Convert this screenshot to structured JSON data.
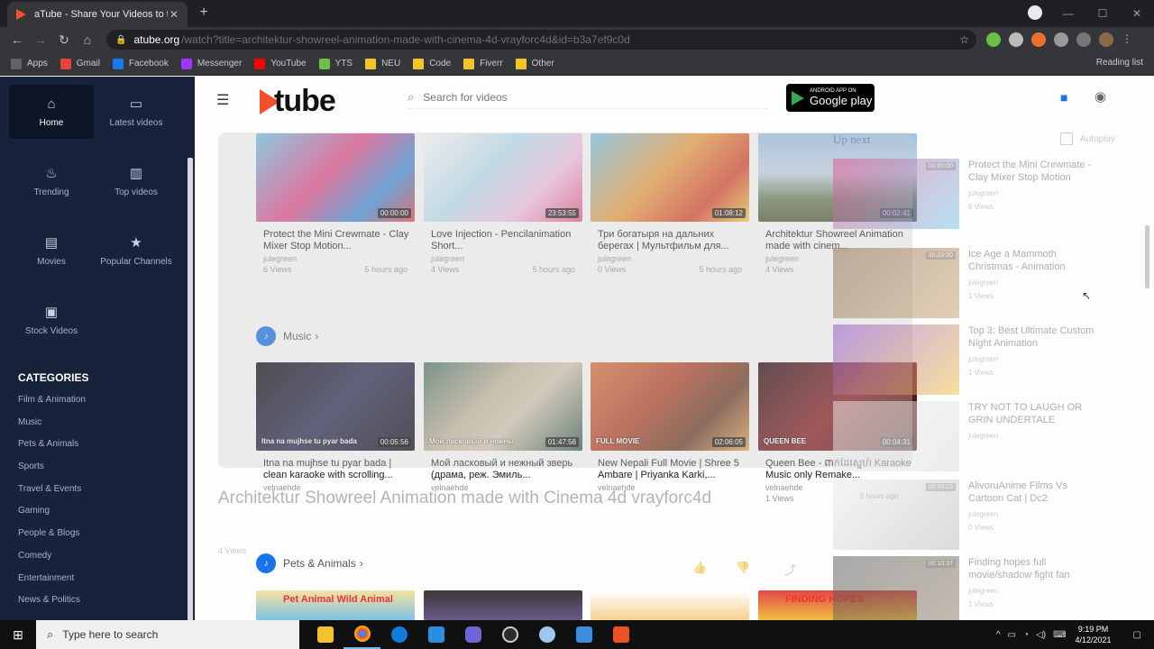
{
  "browser": {
    "tab_title": "aTube - Share Your Videos to the",
    "tab_close": "✕",
    "new_tab": "+",
    "url_host": "atube.org",
    "url_path": "/watch?title=architektur-showreel-animation-made-with-cinema-4d-vrayforc4d&id=b3a7ef9c0d",
    "bookmarks": [
      {
        "label": "Apps",
        "color": "#5f6368",
        "folder": false
      },
      {
        "label": "Gmail",
        "color": "#ea4335",
        "folder": false
      },
      {
        "label": "Facebook",
        "color": "#1877f2",
        "folder": false
      },
      {
        "label": "Messenger",
        "color": "#a033ff",
        "folder": false
      },
      {
        "label": "YouTube",
        "color": "#ff0000",
        "folder": false
      },
      {
        "label": "YTS",
        "color": "#6ac045",
        "folder": false
      },
      {
        "label": "NEU",
        "color": "#f4c22b",
        "folder": true
      },
      {
        "label": "Code",
        "color": "#f4c22b",
        "folder": true
      },
      {
        "label": "Fiverr",
        "color": "#f4c22b",
        "folder": true
      },
      {
        "label": "Other",
        "color": "#f4c22b",
        "folder": true
      }
    ],
    "reading_list": "Reading list"
  },
  "sidebar": {
    "items": [
      {
        "label": "Home",
        "icon": "⌂"
      },
      {
        "label": "Latest videos",
        "icon": "▭"
      },
      {
        "label": "Trending",
        "icon": "♨"
      },
      {
        "label": "Top videos",
        "icon": "▥"
      },
      {
        "label": "Movies",
        "icon": "▤"
      },
      {
        "label": "Popular Channels",
        "icon": "★"
      },
      {
        "label": "Stock Videos",
        "icon": "▣"
      }
    ],
    "categories_title": "CATEGORIES",
    "categories": [
      "Film & Animation",
      "Music",
      "Pets & Animals",
      "Sports",
      "Travel & Events",
      "Gaming",
      "People & Blogs",
      "Comedy",
      "Entertainment",
      "News & Politics"
    ]
  },
  "header": {
    "logo_text": "tube",
    "search_placeholder": "Search for videos",
    "gplay_top": "ANDROID APP ON",
    "gplay_bottom": "Google play"
  },
  "row1": [
    {
      "title": "Protect the Mini Crewmate - Clay Mixer Stop Motion...",
      "channel": "julegreen",
      "views": "6 Views",
      "ago": "5 hours ago",
      "duration": "00:00:00",
      "bg": "linear-gradient(135deg,#6fc6e8 0%,#e64d8c 45%,#3f8fd8 75%,#e24848 100%)"
    },
    {
      "title": "Love Injection - Pencilanimation Short...",
      "channel": "julegreen",
      "views": "4 Views",
      "ago": "5 hours ago",
      "duration": "23:53:55",
      "bg": "linear-gradient(135deg,#ffffff 0%,#bfe3f3 40%,#f7c6e8 70%,#e65a8a 100%)"
    },
    {
      "title": "Три богатыря на дальних берегах | Мультфильм для...",
      "channel": "julegreen",
      "views": "0 Views",
      "ago": "5 hours ago",
      "duration": "01:08:12",
      "bg": "linear-gradient(135deg,#7bc6e9 0%,#f0a043 45%,#d9452f 75%,#f6d24a 100%)"
    },
    {
      "title": "Architektur Showreel Animation made with cinem...",
      "channel": "julegreen",
      "views": "4 Views",
      "ago": "",
      "duration": "00:02:41",
      "bg": "linear-gradient(180deg,#9ec3e5 0%,#c7d6e6 45%,#6a7c55 75%,#4f5d3a 100%)"
    }
  ],
  "music_label": "Music",
  "row2": [
    {
      "title": "Itna na mujhse tu pyar bada | clean karaoke with scrolling...",
      "channel": "velnaehde",
      "views": "",
      "ago": "",
      "duration": "00:05:56",
      "caption": "Itna na mujhse tu pyar bada",
      "bg": "linear-gradient(135deg,#0d0d12 0%,#2a2a52 50%,#101018 100%)"
    },
    {
      "title": "Мой ласковый и нежный зверь (драма, реж. Эмиль...",
      "channel": "velnaehde",
      "views": "",
      "ago": "",
      "duration": "01:47:58",
      "caption": "Мой ласковый и нежны",
      "bg": "linear-gradient(135deg,#4e7a6a 0%,#c9b9a0 40%,#d8cbb6 60%,#3d5c4d 100%)"
    },
    {
      "title": "New Nepali Full Movie | Shree 5 Ambare | Priyanka Karki,...",
      "channel": "velnaehde",
      "views": "",
      "ago": "",
      "duration": "02:06:05",
      "caption": "FULL MOVIE",
      "bg": "linear-gradient(135deg,#d9733d 0%,#b8452a 40%,#6a3b25 70%,#e8a35a 100%)"
    },
    {
      "title": "Queen Bee - ពាក់ដៃស្នេហ៍ Karaoke Music only Remake...",
      "channel": "velnaehde",
      "views": "1 Views",
      "ago": "",
      "duration": "00:04:31",
      "caption": "QUEEN BEE",
      "bg": "linear-gradient(135deg,#2b0d10 0%,#8a1c20 50%,#3a1010 100%)"
    }
  ],
  "pets_label": "Pets & Animals",
  "row3_captions": [
    "Pet Animal Wild Animal",
    "",
    "",
    "FINDING HOPES"
  ],
  "overlay": {
    "video_title": "Architektur Showreel Animation made with Cinema 4d vrayforc4d",
    "views": "4 Views",
    "up_next": "Up next",
    "autoplay": "Autoplay",
    "suggestions": [
      {
        "title": "Protect the Mini Crewmate - Clay Mixer Stop Motion",
        "channel": "julegreen",
        "views": "6 Views",
        "duration": "00:00:00"
      },
      {
        "title": "Ice Age a Mammoth Christmas - Animation",
        "channel": "julegreen",
        "views": "1 Views",
        "duration": "00:23:00"
      },
      {
        "title": "Top 3: Best Ultimate Custom Night Animation",
        "channel": "julegreen",
        "views": "1 Views",
        "duration": ""
      },
      {
        "title": "TRY NOT TO LAUGH OR GRIN UNDERTALE",
        "channel": "julegreen",
        "views": "",
        "duration": ""
      },
      {
        "title": "AlivoruAnime Films Vs Cartoon Cat | Dc2",
        "channel": "julegreen",
        "views": "0 Views",
        "duration": "00:03:23",
        "ago": "6 hours ago"
      },
      {
        "title": "Finding hopes full movie/shadow fight fan",
        "channel": "julegreen",
        "views": "1 Views",
        "duration": "00:10:37"
      }
    ]
  },
  "taskbar": {
    "search_placeholder": "Type here to search",
    "time": "9:19 PM",
    "date": "4/12/2021"
  }
}
